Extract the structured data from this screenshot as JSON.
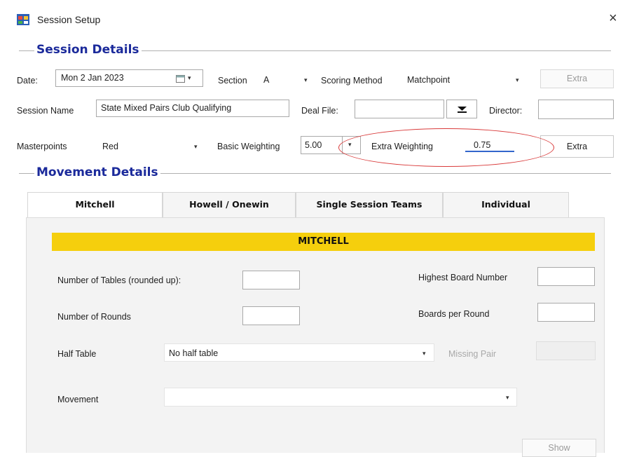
{
  "window": {
    "title": "Session Setup",
    "close_label": "×"
  },
  "session_details": {
    "heading": "Session Details",
    "date_label": "Date:",
    "date_value": "Mon  2 Jan  2023",
    "section_label": "Section",
    "section_value": "A",
    "scoring_method_label": "Scoring Method",
    "scoring_method_value": "Matchpoint",
    "extra_top_label": "Extra",
    "session_name_label": "Session Name",
    "session_name_value": "State Mixed Pairs Club Qualifying",
    "deal_file_label": "Deal File:",
    "deal_file_value": "",
    "director_label": "Director:",
    "director_value": "",
    "masterpoints_label": "Masterpoints",
    "masterpoints_value": "Red",
    "basic_weighting_label": "Basic Weighting",
    "basic_weighting_value": "5.00",
    "extra_weighting_label": "Extra Weighting",
    "extra_weighting_value": "0.75",
    "extra_button_label": "Extra"
  },
  "movement_details": {
    "heading": "Movement Details",
    "tabs": [
      {
        "label": "Mitchell",
        "active": true
      },
      {
        "label": "Howell / Onewin",
        "active": false
      },
      {
        "label": "Single Session Teams",
        "active": false
      },
      {
        "label": "Individual",
        "active": false
      }
    ],
    "banner": "MITCHELL",
    "num_tables_label": "Number of Tables (rounded up):",
    "num_tables_value": "",
    "num_rounds_label": "Number of Rounds",
    "num_rounds_value": "",
    "highest_board_label": "Highest Board Number",
    "highest_board_value": "",
    "boards_per_round_label": "Boards per Round",
    "boards_per_round_value": "",
    "half_table_label": "Half Table",
    "half_table_value": "No half table",
    "missing_pair_label": "Missing Pair",
    "missing_pair_value": "",
    "movement_label": "Movement",
    "movement_value": "",
    "show_button_label": "Show"
  },
  "colors": {
    "heading_blue": "#1b2a9b",
    "banner_yellow": "#f5cf0d",
    "annotation_red": "#d93a3a",
    "underline_blue": "#3366cc"
  },
  "icons": [
    "app-icon",
    "close-icon",
    "calendar-icon",
    "dropdown-arrow-icon"
  ]
}
